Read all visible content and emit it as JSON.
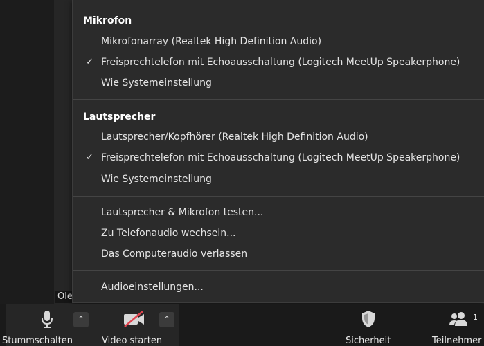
{
  "participant": {
    "name": "Ole"
  },
  "menu": {
    "microphone": {
      "title": "Mikrofon",
      "items": [
        {
          "label": "Mikrofonarray (Realtek High Definition Audio)",
          "checked": false
        },
        {
          "label": "Freisprechtelefon mit Echoausschaltung (Logitech MeetUp Speakerphone)",
          "checked": true
        },
        {
          "label": "Wie Systemeinstellung",
          "checked": false
        }
      ]
    },
    "speaker": {
      "title": "Lautsprecher",
      "items": [
        {
          "label": "Lautsprecher/Kopfhörer (Realtek High Definition Audio)",
          "checked": false
        },
        {
          "label": "Freisprechtelefon mit Echoausschaltung (Logitech MeetUp Speakerphone)",
          "checked": true
        },
        {
          "label": "Wie Systemeinstellung",
          "checked": false
        }
      ]
    },
    "actions": {
      "test": "Lautsprecher & Mikrofon testen...",
      "phone": "Zu Telefonaudio wechseln...",
      "leave": "Das Computeraudio verlassen"
    },
    "settings": "Audioeinstellungen...",
    "check_mark": "✓"
  },
  "toolbar": {
    "mute_label": "Stummschalten",
    "video_label": "Video starten",
    "security_label": "Sicherheit",
    "participants_label": "Teilnehmer",
    "participants_count": "1",
    "caret": "^"
  },
  "icons": {
    "mute": "microphone-icon",
    "video": "video-off-icon",
    "security": "shield-icon",
    "participants": "participants-icon",
    "caret": "caret-up-icon",
    "check": "checkmark-icon"
  }
}
